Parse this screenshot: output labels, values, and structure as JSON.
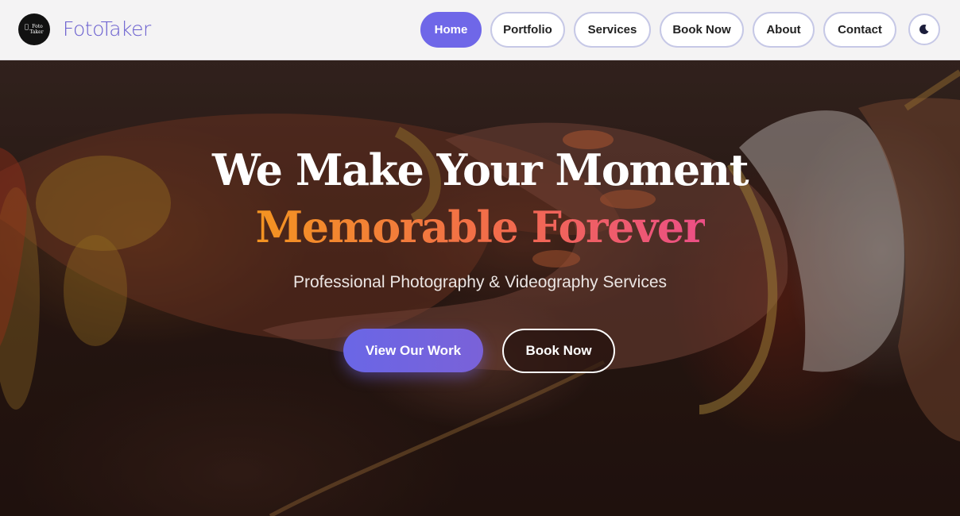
{
  "brand": {
    "name": "FotoTaker",
    "badge_line1": "Foto",
    "badge_line2": "Taker"
  },
  "nav": {
    "items": [
      {
        "label": "Home",
        "active": true
      },
      {
        "label": "Portfolio",
        "active": false
      },
      {
        "label": "Services",
        "active": false
      },
      {
        "label": "Book Now",
        "active": false
      },
      {
        "label": "About",
        "active": false
      },
      {
        "label": "Contact",
        "active": false
      }
    ],
    "theme_toggle_icon": "moon-icon"
  },
  "hero": {
    "headline_line1": "We Make Your Moment",
    "headline_line2": "Memorable Forever",
    "subtitle": "Professional Photography & Videography Services",
    "primary_cta": "View Our Work",
    "secondary_cta": "Book Now"
  },
  "colors": {
    "accent": "#6f67e8",
    "gradient_start": "#f39421",
    "gradient_end": "#ec4f86"
  }
}
